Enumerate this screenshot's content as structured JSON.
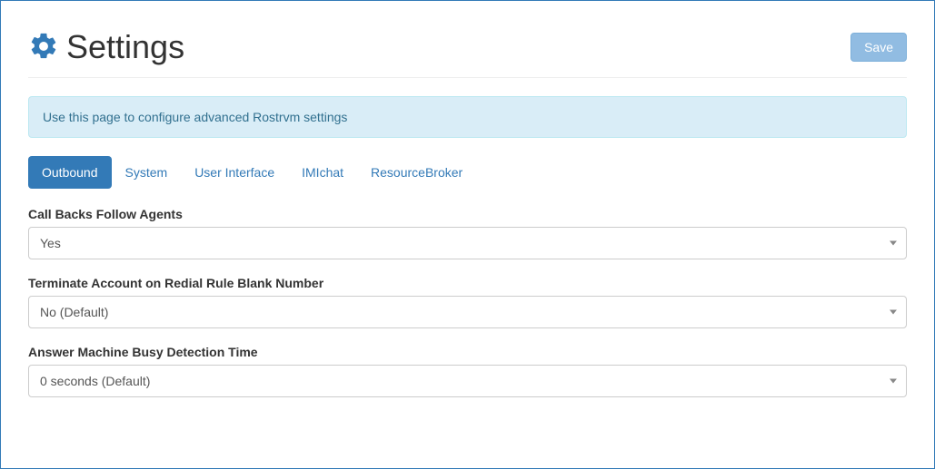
{
  "header": {
    "title": "Settings",
    "save_label": "Save"
  },
  "info": {
    "message": "Use this page to configure advanced Rostrvm settings"
  },
  "tabs": {
    "items": [
      {
        "label": "Outbound",
        "active": true
      },
      {
        "label": "System",
        "active": false
      },
      {
        "label": "User Interface",
        "active": false
      },
      {
        "label": "IMIchat",
        "active": false
      },
      {
        "label": "ResourceBroker",
        "active": false
      }
    ]
  },
  "fields": {
    "callbacks": {
      "label": "Call Backs Follow Agents",
      "value": "Yes"
    },
    "terminate": {
      "label": "Terminate Account on Redial Rule Blank Number",
      "value": "No (Default)"
    },
    "amd": {
      "label": "Answer Machine Busy Detection Time",
      "value": "0 seconds (Default)"
    }
  }
}
